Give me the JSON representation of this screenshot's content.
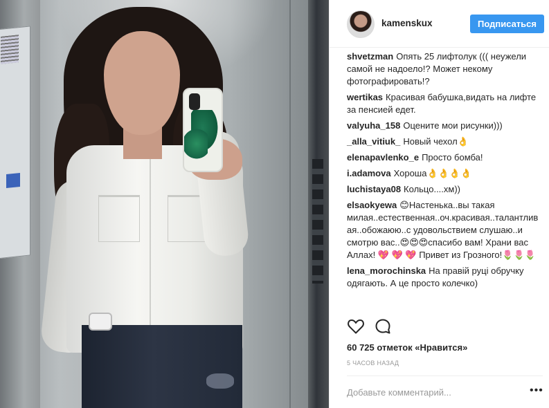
{
  "post": {
    "author": "kamenskux",
    "follow_label": "Подписаться",
    "likes_text": "60 725 отметок «Нравится»",
    "time_ago": "5 ЧАСОВ НАЗАД"
  },
  "comments": [
    {
      "user": "shvetzman",
      "text": "Опять 25 лифтолук ((( неужели самой не надоело!? Может некому фотографировать!?"
    },
    {
      "user": "wertikas",
      "text": "Красивая бабушка,видать на лифте за пенсией едет."
    },
    {
      "user": "valyuha_158",
      "text": "Оцените мои рисунки)))"
    },
    {
      "user": "_alla_vitiuk_",
      "text": "Новый чехол👌"
    },
    {
      "user": "elenapavlenko_e",
      "text": "Просто бомба!"
    },
    {
      "user": "i.adamova",
      "text": "Хороша👌👌👌👌"
    },
    {
      "user": "luchistaya08",
      "text": "Кольцо....хм))"
    },
    {
      "user": "elsaokyewa",
      "text": "😊Настенька..вы такая милая..естественная..оч.красивая..талантливая..обожаюю..с удовольствием слушаю..и смотрю вас..😍😍😍спасибо вам! Храни вас Аллах! 💖 💖 💖 Привет из Грозного!🌷🌷🌷"
    },
    {
      "user": "lena_morochinska",
      "text": "На правій руці обручку одягають. А це просто колечко)"
    }
  ],
  "add_comment": {
    "placeholder": "Добавьте комментарий...",
    "value": ""
  },
  "icons": {
    "like": "heart-icon",
    "comment": "speech-bubble-icon",
    "more": "more-options-icon"
  },
  "colors": {
    "accent": "#3897f0",
    "text": "#262626",
    "muted": "#999999",
    "border": "#efefef"
  }
}
